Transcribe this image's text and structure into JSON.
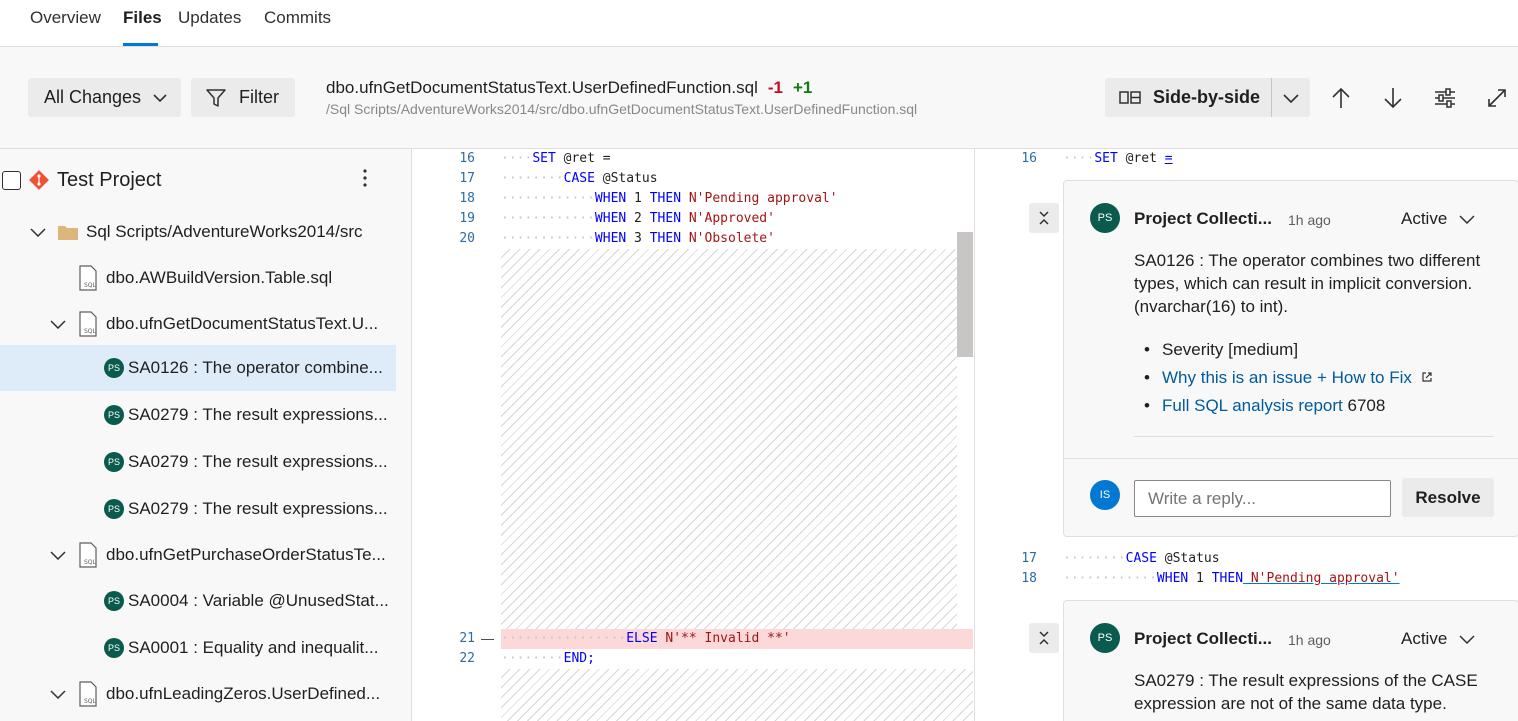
{
  "tabs": [
    {
      "label": "Overview"
    },
    {
      "label": "Files"
    },
    {
      "label": "Updates"
    },
    {
      "label": "Commits"
    }
  ],
  "toolbar": {
    "all_changes_label": "All Changes",
    "filter_label": "Filter",
    "file_name": "dbo.ufnGetDocumentStatusText.UserDefinedFunction.sql",
    "deletions": "-1",
    "additions": "+1",
    "file_path": "/Sql Scripts/AdventureWorks2014/src/dbo.ufnGetDocumentStatusText.UserDefinedFunction.sql",
    "view_mode_label": "Side-by-side"
  },
  "sidebar": {
    "project_name": "Test Project",
    "folder": "Sql Scripts/AdventureWorks2014/src",
    "files": [
      "dbo.AWBuildVersion.Table.sql",
      "dbo.ufnGetDocumentStatusText.U...",
      "dbo.ufnGetPurchaseOrderStatusTe...",
      "dbo.ufnLeadingZeros.UserDefined..."
    ],
    "comments": [
      "SA0126 : The operator combine...",
      "SA0279 : The result expressions...",
      "SA0279 : The result expressions...",
      "SA0279 : The result expressions...",
      "SA0004 : Variable @UnusedStat...",
      "SA0001 : Equality and inequalit..."
    ],
    "avatar_initials": "PS"
  },
  "left_code": {
    "line_numbers": [
      "16",
      "17",
      "18",
      "19",
      "20",
      "21",
      "22"
    ],
    "deleted_marker": "—",
    "l16_kw": "SET",
    "l16_rest": " @ret =",
    "l17_kw": "CASE",
    "l17_rest": " @Status",
    "l18_kw1": "WHEN",
    "l18_num": " 1 ",
    "l18_kw2": "THEN",
    "l18_str": " N'Pending approval'",
    "l19_kw1": "WHEN",
    "l19_num": " 2 ",
    "l19_kw2": "THEN",
    "l19_str": " N'Approved'",
    "l20_kw1": "WHEN",
    "l20_num": " 3 ",
    "l20_kw2": "THEN",
    "l20_str": " N'Obsolete'",
    "l21_kw": "ELSE",
    "l21_str": " N'** Invalid **'",
    "l22_kw": "END;"
  },
  "right_code": {
    "line_numbers": [
      "16",
      "17",
      "18"
    ],
    "l16_kw": "SET",
    "l16_rest": " @ret ",
    "l16_eq": "=",
    "l17_kw": "CASE",
    "l17_rest": " @Status",
    "l18_kw1": "WHEN",
    "l18_num": " 1 ",
    "l18_kw2": "THEN",
    "l18_str": " N'Pending approval'"
  },
  "comment1": {
    "author": "Project Collecti...",
    "time": "1h ago",
    "status": "Active",
    "avatar": "PS",
    "text": "SA0126 : The operator combines two different types, which can result in implicit conversion. (nvarchar(16) to int).",
    "severity": "Severity [medium]",
    "link1": "Why this is an issue + How to Fix",
    "link2": "Full SQL analysis report",
    "report_number": "6708",
    "reply_placeholder": "Write a reply...",
    "reply_avatar": "IS",
    "resolve_label": "Resolve"
  },
  "comment2": {
    "author": "Project Collecti...",
    "time": "1h ago",
    "status": "Active",
    "avatar": "PS",
    "text": "SA0279 : The result expressions of the CASE expression are not of the same data type."
  }
}
